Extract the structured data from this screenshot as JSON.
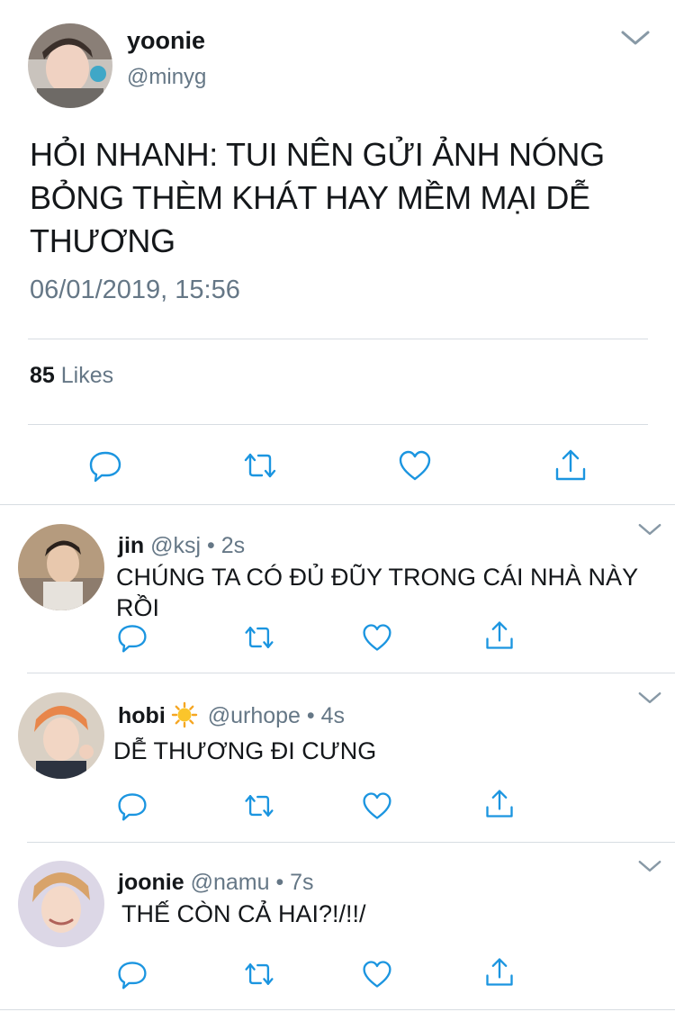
{
  "main_tweet": {
    "author_name": "yoonie",
    "author_handle": "@minyg",
    "text": "HỎI NHANH: TUI NÊN GỬI ẢNH NÓNG BỎNG THÈM KHÁT HAY MỀM MẠI DỄ THƯƠNG",
    "timestamp": "06/01/2019, 15:56",
    "likes_count": "85",
    "likes_label": "Likes"
  },
  "replies": [
    {
      "name": "jin",
      "handle": "@ksj",
      "separator": "•",
      "time": "2s",
      "text": "CHÚNG TA CÓ ĐỦ ĐŨY TRONG CÁI NHÀ NÀY RỒI"
    },
    {
      "name": "hobi",
      "emoji": "sun-emoji",
      "handle": "@urhope",
      "separator": "•",
      "time": "4s",
      "text": "DỄ THƯƠNG ĐI CƯNG"
    },
    {
      "name": "joonie",
      "handle": "@namu",
      "separator": "•",
      "time": "7s",
      "text": "THẾ CÒN CẢ HAI?!/!!/"
    }
  ],
  "icons": [
    "reply-icon",
    "retweet-icon",
    "like-icon",
    "share-icon",
    "chevron-down-icon"
  ],
  "colors": {
    "text": "#14171a",
    "muted": "#657786",
    "icon": "#1b95e0",
    "divider": "#d7dde2"
  }
}
